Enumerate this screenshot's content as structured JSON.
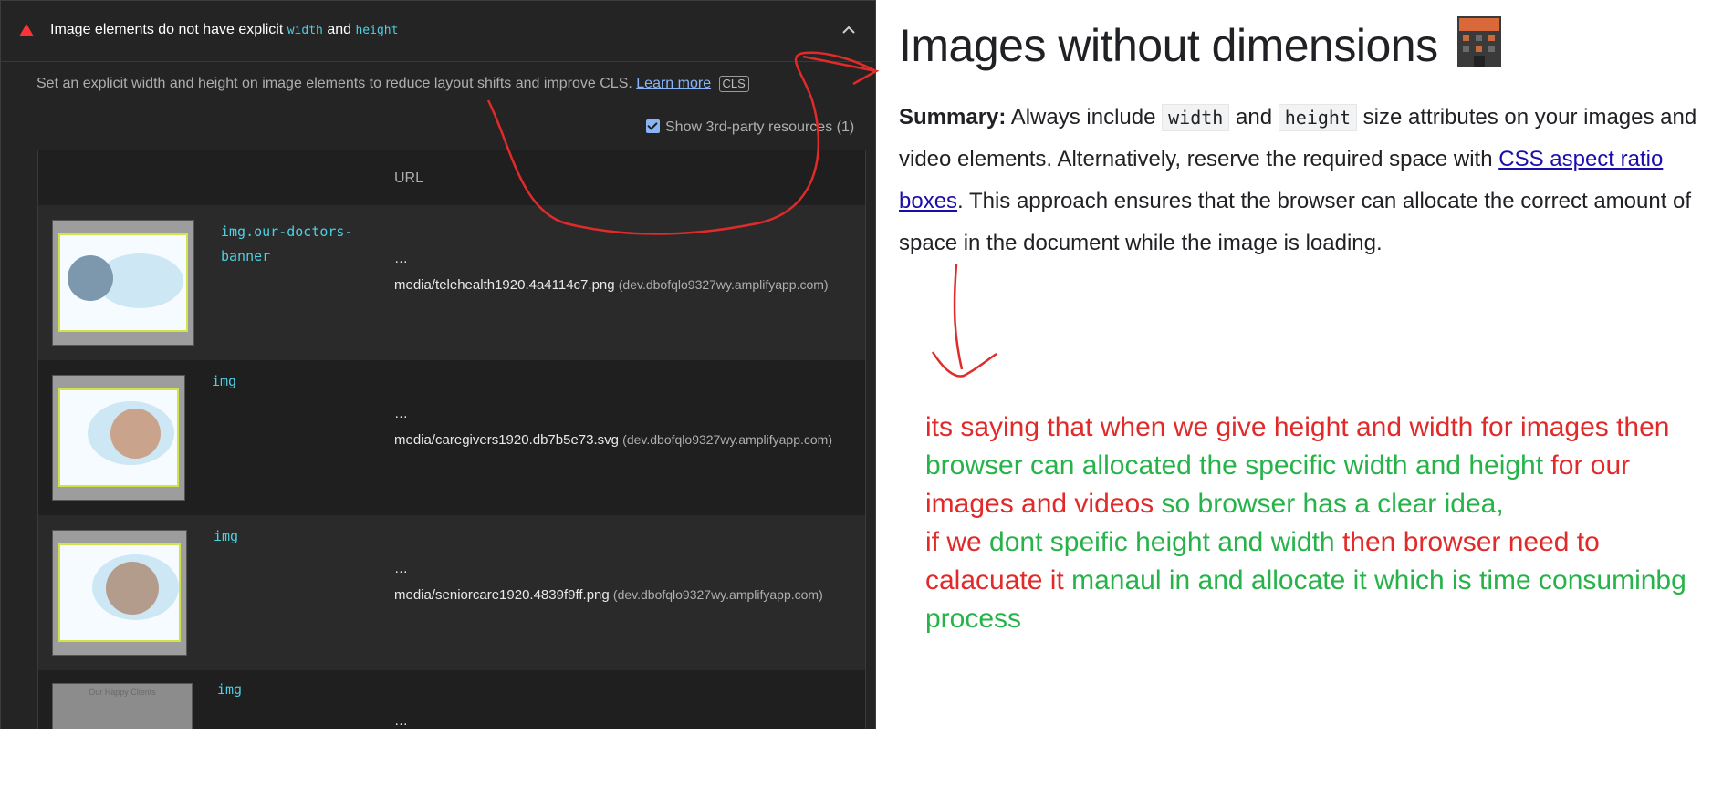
{
  "audit": {
    "title_prefix": "Image elements do not have explicit",
    "title_code1": "width",
    "title_and": "and",
    "title_code2": "height",
    "description": "Set an explicit width and height on image elements to reduce layout shifts and improve CLS.",
    "learn_more": "Learn more",
    "badge": "CLS",
    "third_party_label": "Show 3rd-party resources (1)",
    "column_url": "URL",
    "rows": [
      {
        "node": "img.our-doctors-banner",
        "dots": "…",
        "path": "media/telehealth1920.4a4114c7.png",
        "host": "(dev.dbofqlo9327wy.amplifyapp.com)"
      },
      {
        "node": "img",
        "dots": "…",
        "path": "media/caregivers1920.db7b5e73.svg",
        "host": "(dev.dbofqlo9327wy.amplifyapp.com)"
      },
      {
        "node": "img",
        "dots": "…",
        "path": "media/seniorcare1920.4839f9ff.png",
        "host": "(dev.dbofqlo9327wy.amplifyapp.com)"
      },
      {
        "node": "img",
        "dots": "…",
        "path": "",
        "host": ""
      }
    ],
    "thumb4_text": "Our Happy Clients"
  },
  "article": {
    "title": "Images without dimensions",
    "summary_label": "Summary:",
    "summary_1": "Always include",
    "code_width": "width",
    "summary_and": "and",
    "code_height": "height",
    "summary_2": "size attributes on your images and video elements. Alternatively, reserve the required space with",
    "link_text": "CSS aspect ratio boxes",
    "summary_3": ". This approach ensures that the browser can allocate the correct amount of space in the document while the image is loading."
  },
  "note": {
    "p1_red_a": "its saying that when we give height and width for images then",
    "p1_green_a": "browser can allocated the specific width and height",
    "p1_red_b": "for our images and videos",
    "p1_green_b": "so browser has a clear idea,",
    "p2_red_a": "if we",
    "p2_green_a": "dont speific height and width",
    "p2_red_b": "then browser need to calacuate it",
    "p2_green_b": "manaul in and allocate it which is time consuminbg process"
  },
  "colors": {
    "annotation_red": "#e12a2a",
    "annotation_green": "#27b34a",
    "node_teal": "#4dd0e1",
    "link_blue": "#1a0dab"
  },
  "icons": [
    "fail-triangle-icon",
    "chevron-up-icon",
    "checkbox-icon",
    "building-emoji-icon"
  ]
}
